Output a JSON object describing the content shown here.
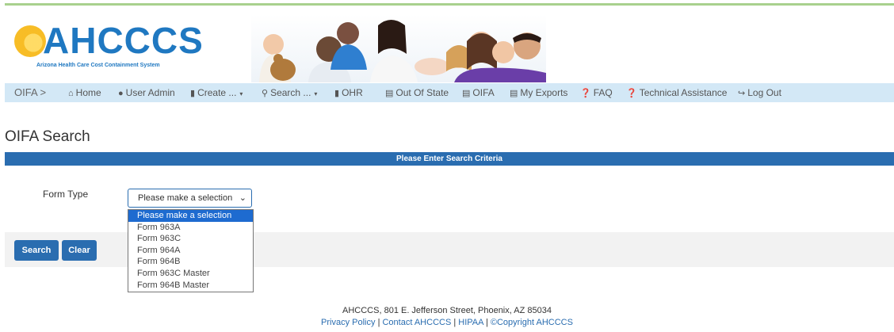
{
  "header": {
    "logo_text": "AHCCCS",
    "logo_subtitle": "Arizona Health Care Cost Containment System"
  },
  "nav": {
    "brand": "OIFA >",
    "items": [
      {
        "label": "Home",
        "icon": "home-icon"
      },
      {
        "label": "User Admin",
        "icon": "user-icon"
      },
      {
        "label": "Create ...",
        "icon": "document-icon",
        "dropdown": true
      },
      {
        "label": "Search ...",
        "icon": "search-icon",
        "dropdown": true
      },
      {
        "label": "OHR",
        "icon": "document-icon"
      },
      {
        "label": "Out Of State",
        "icon": "list-icon"
      },
      {
        "label": "OIFA",
        "icon": "list-icon"
      },
      {
        "label": "My Exports",
        "icon": "list-icon"
      },
      {
        "label": "FAQ",
        "icon": "question-icon"
      },
      {
        "label": "Technical Assistance",
        "icon": "question-icon"
      },
      {
        "label": "Log Out",
        "icon": "logout-icon"
      }
    ]
  },
  "page": {
    "title": "OIFA Search",
    "criteria_header": "Please Enter Search Criteria"
  },
  "form": {
    "form_type_label": "Form Type",
    "selected_value": "Please make a selection",
    "options": [
      "Please make a selection",
      "Form 963A",
      "Form 963C",
      "Form 964A",
      "Form 964B",
      "Form 963C Master",
      "Form 964B Master"
    ]
  },
  "buttons": {
    "search": "Search",
    "clear": "Clear"
  },
  "footer": {
    "address": "AHCCCS, 801 E. Jefferson Street, Phoenix, AZ 85034",
    "privacy": "Privacy Policy",
    "contact": "Contact AHCCCS",
    "hipaa": "HIPAA",
    "copyright": "©Copyright AHCCCS",
    "separator": "|"
  },
  "colors": {
    "accent": "#2a6db0",
    "nav_bg": "#d3e8f6",
    "selected_option": "#1e6bd0",
    "top_line": "#a9d18e"
  }
}
